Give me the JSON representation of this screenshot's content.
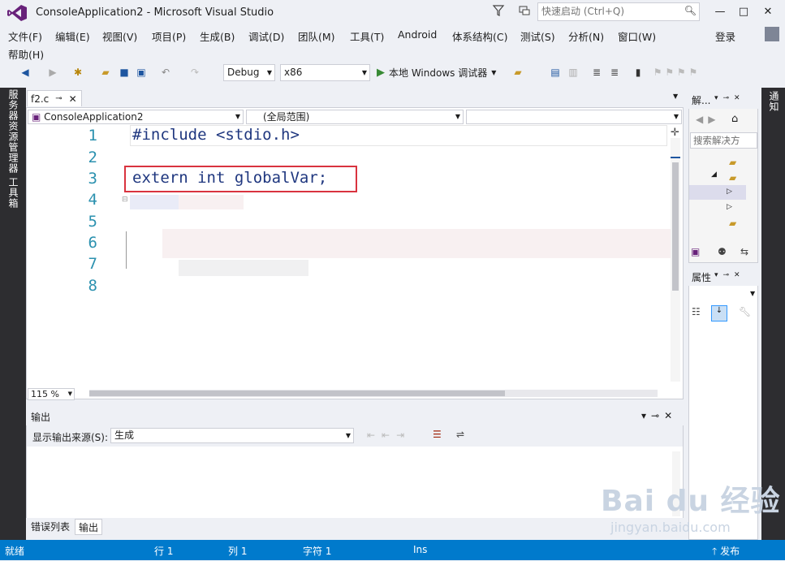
{
  "window": {
    "title": "ConsoleApplication2 - Microsoft Visual Studio",
    "minimize": "—",
    "maximize": "□",
    "close": "✕"
  },
  "quick_launch": {
    "placeholder": "快速启动 (Ctrl+Q)"
  },
  "menu": [
    "文件(F)",
    "编辑(E)",
    "视图(V)",
    "项目(P)",
    "生成(B)",
    "调试(D)",
    "团队(M)",
    "工具(T)",
    "Android",
    "体系结构(C)",
    "测试(S)",
    "分析(N)",
    "窗口(W)",
    "帮助(H)"
  ],
  "login": "登录",
  "toolbar": {
    "config": "Debug",
    "platform": "x86",
    "run_label": "本地 Windows 调试器"
  },
  "left_tabs": [
    "服务器资源管理器",
    "工具箱"
  ],
  "right_tabs": [
    "通知"
  ],
  "editor": {
    "tab_name": "f2.c",
    "project_combo": "ConsoleApplication2",
    "scope_combo": "(全局范围)",
    "line_numbers": [
      "1",
      "2",
      "3",
      "4",
      "5",
      "6",
      "7",
      "8"
    ],
    "code_line1": "#include <stdio.h>",
    "code_line3": "extern int globalVar;",
    "zoom": "115 %"
  },
  "output": {
    "title": "输出",
    "source_label": "显示输出来源(S):",
    "source_value": "生成"
  },
  "bottom_tabs": [
    "错误列表",
    "输出"
  ],
  "solution_explorer": {
    "title": "解...",
    "search_placeholder": "搜索解决方"
  },
  "properties": {
    "title": "属性"
  },
  "status": {
    "ready": "就绪",
    "line": "行 1",
    "col": "列 1",
    "char": "字符 1",
    "mode": "Ins",
    "publish": "发布"
  },
  "watermark": {
    "brand": "Bai du 经验",
    "url": "jingyan.baidu.com"
  },
  "colors": {
    "accent": "#007acc",
    "highlight_box": "#d9333f",
    "vs_purple": "#68217a"
  }
}
